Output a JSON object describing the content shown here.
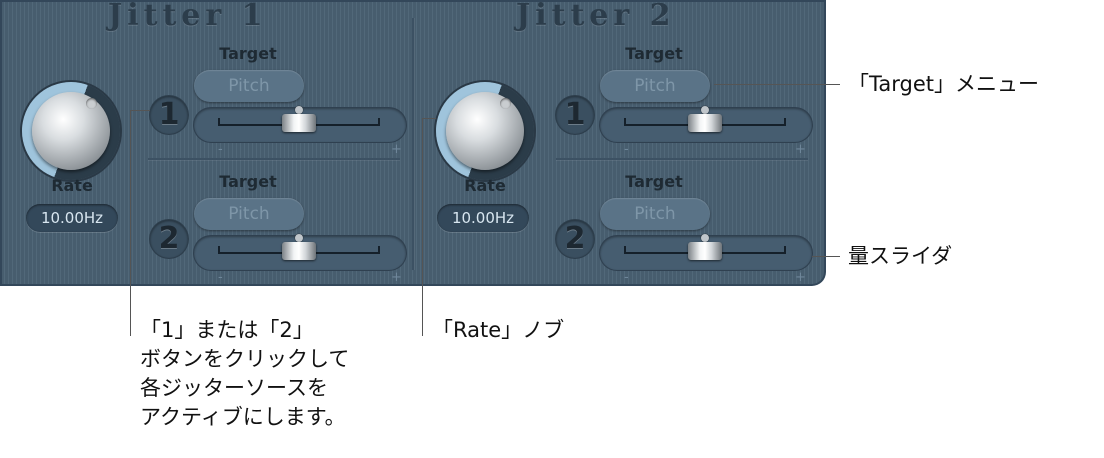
{
  "jitter1": {
    "title": "Jitter 1",
    "rate_label": "Rate",
    "rate_value": "10.00Hz",
    "source1": {
      "button": "1",
      "target_label": "Target",
      "target_value": "Pitch",
      "amount": 0.5,
      "minus": "-",
      "plus": "+"
    },
    "source2": {
      "button": "2",
      "target_label": "Target",
      "target_value": "Pitch",
      "amount": 0.5,
      "minus": "-",
      "plus": "+"
    }
  },
  "jitter2": {
    "title": "Jitter 2",
    "rate_label": "Rate",
    "rate_value": "10.00Hz",
    "source1": {
      "button": "1",
      "target_label": "Target",
      "target_value": "Pitch",
      "amount": 0.5,
      "minus": "-",
      "plus": "+"
    },
    "source2": {
      "button": "2",
      "target_label": "Target",
      "target_value": "Pitch",
      "amount": 0.5,
      "minus": "-",
      "plus": "+"
    }
  },
  "callouts": {
    "target_menu": "「Target」メニュー",
    "amount_slider": "量スライダ",
    "source_buttons": "「1」または「2」\nボタンをクリックして\n各ジッターソースを\nアクティブにします。",
    "rate_knob": "「Rate」ノブ"
  },
  "colors": {
    "panel": "#4b6274",
    "knob_ring": "#9fc4dc"
  }
}
